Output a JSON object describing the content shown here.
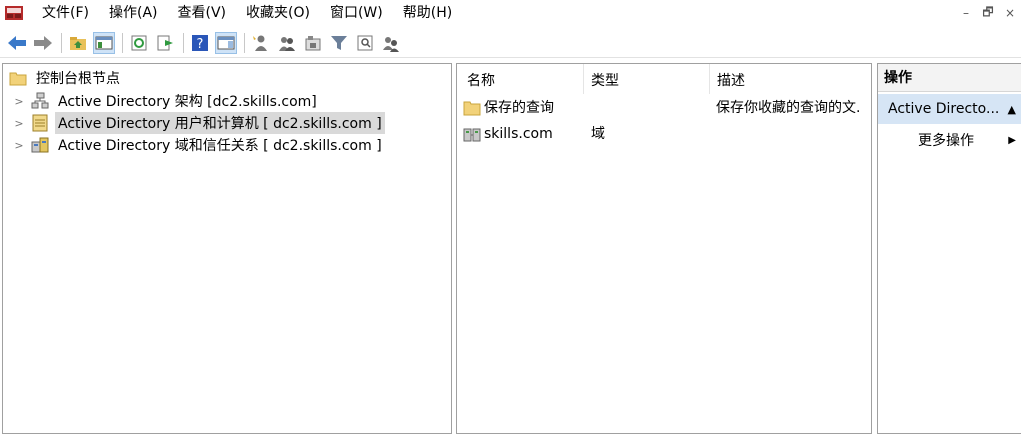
{
  "menubar": {
    "items": [
      {
        "label": "文件(F)"
      },
      {
        "label": "操作(A)"
      },
      {
        "label": "查看(V)"
      },
      {
        "label": "收藏夹(O)"
      },
      {
        "label": "窗口(W)"
      },
      {
        "label": "帮助(H)"
      }
    ],
    "window_controls": {
      "minimize": "–",
      "restore": "🗗",
      "close": "×"
    }
  },
  "toolbar": {
    "icons": [
      "back-icon",
      "forward-icon",
      "up-folder-icon",
      "show-hide-tree-icon",
      "refresh-icon",
      "export-list-icon",
      "help-icon",
      "show-hide-action-pane-icon",
      "new-user-icon",
      "new-group-icon",
      "new-ou-icon",
      "filter-icon",
      "find-icon",
      "add-to-group-icon"
    ],
    "accent": "#3a79c9"
  },
  "tree": {
    "root": {
      "label": "控制台根节点"
    },
    "items": [
      {
        "label": "Active Directory 架构 [dc2.skills.com]",
        "icon": "schema-icon"
      },
      {
        "label": "Active Directory 用户和计算机 [ dc2.skills.com ]",
        "icon": "users-computers-icon",
        "selected": true
      },
      {
        "label": "Active Directory 域和信任关系 [ dc2.skills.com ]",
        "icon": "domains-trusts-icon"
      }
    ]
  },
  "details": {
    "columns": [
      "名称",
      "类型",
      "描述"
    ],
    "rows": [
      {
        "name": "保存的查询",
        "type": "",
        "description": "保存你收藏的查询的文.",
        "icon": "folder-icon"
      },
      {
        "name": "skills.com",
        "type": "域",
        "description": "",
        "icon": "domain-icon"
      }
    ]
  },
  "actions": {
    "header": "操作",
    "group": "Active Directo...",
    "items": [
      {
        "label": "更多操作"
      }
    ]
  },
  "colors": {
    "selection": "#d9d9d9",
    "actions_group_bg": "#d6e5f5",
    "pane_border": "#a0a0a0"
  }
}
